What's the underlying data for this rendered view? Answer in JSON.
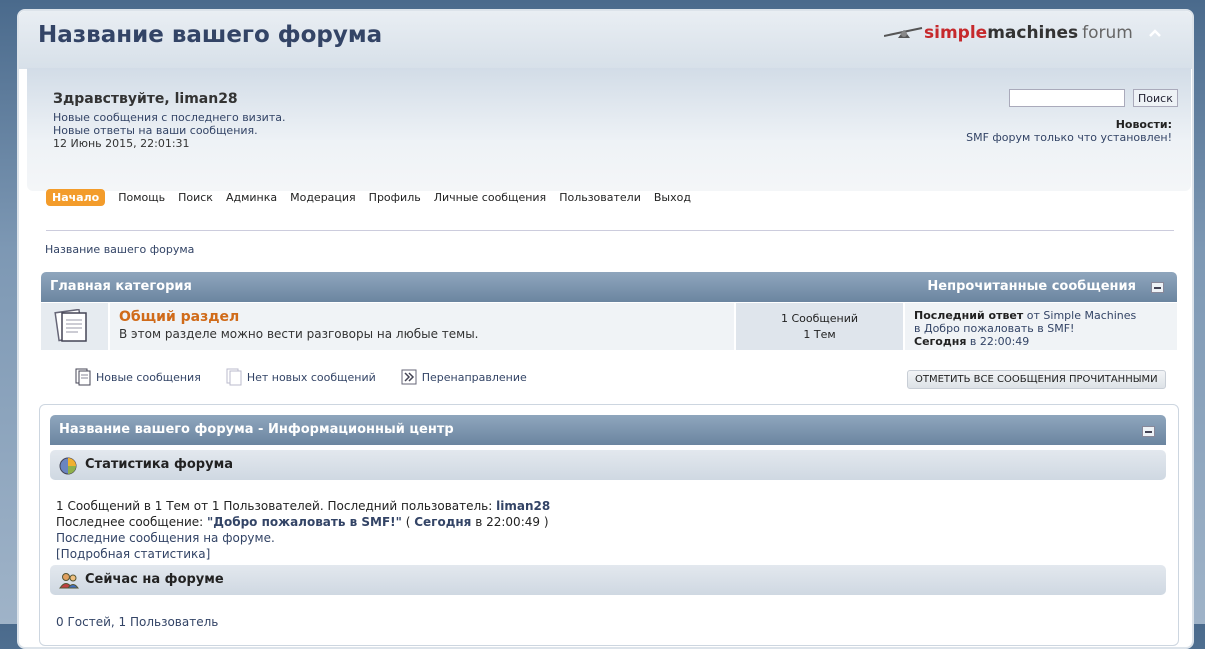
{
  "header": {
    "forum_title": "Название вашего форума",
    "logo_simple": "simple",
    "logo_machines": "machines",
    "logo_forum": "forum",
    "collapse_icon": "chevron-up-icon"
  },
  "user": {
    "greeting": "Здравствуйте, liman28",
    "new_posts_link": "Новые сообщения с последнего визита.",
    "new_replies_link": "Новые ответы на ваши сообщения.",
    "datetime": "12 Июнь 2015, 22:01:31"
  },
  "search": {
    "value": "",
    "button_label": "Поиск"
  },
  "news": {
    "label": "Новости:",
    "text": "SMF форум только что установлен!"
  },
  "menu": {
    "items": [
      "Начало",
      "Помощь",
      "Поиск",
      "Админка",
      "Модерация",
      "Профиль",
      "Личные сообщения",
      "Пользователи",
      "Выход"
    ],
    "active": "Начало"
  },
  "breadcrumb": "Название вашего форума",
  "category": {
    "title": "Главная категория",
    "unread_link": "Непрочитанные сообщения",
    "boards": [
      {
        "name": "Общий раздел",
        "description": "В этом разделе можно вести разговоры на любые темы.",
        "posts": "1 Сообщений",
        "topics": "1 Тем",
        "last_label": "Последний ответ",
        "last_by": "от Simple Machines",
        "last_topic": "в Добро пожаловать в SMF!",
        "last_when_bold": "Сегодня",
        "last_when_rest": "в 22:00:49"
      }
    ]
  },
  "legend": {
    "new_posts": "Новые сообщения",
    "no_new_posts": "Нет новых сообщений",
    "redirect": "Перенаправление",
    "mark_read_button": "Отметить все сообщения прочитанными"
  },
  "info_center": {
    "title": "Название вашего форума - Информационный центр",
    "stats_title": "Статистика форума",
    "stats_line1_prefix": "1 Сообщений в 1 Тем от 1 Пользователей. Последний пользователь:",
    "stats_line1_user": "liman28",
    "stats_line2_prefix": "Последнее сообщение:",
    "stats_line2_topic": "\"Добро пожаловать в SMF!\"",
    "stats_line2_open": "(",
    "stats_line2_when_bold": "Сегодня",
    "stats_line2_when_rest": "в 22:00:49 )",
    "stats_line3": "Последние сообщения на форуме.",
    "stats_line4": "[Подробная статистика]",
    "online_title": "Сейчас на форуме",
    "online_text": "0 Гостей, 1 Пользователь"
  }
}
